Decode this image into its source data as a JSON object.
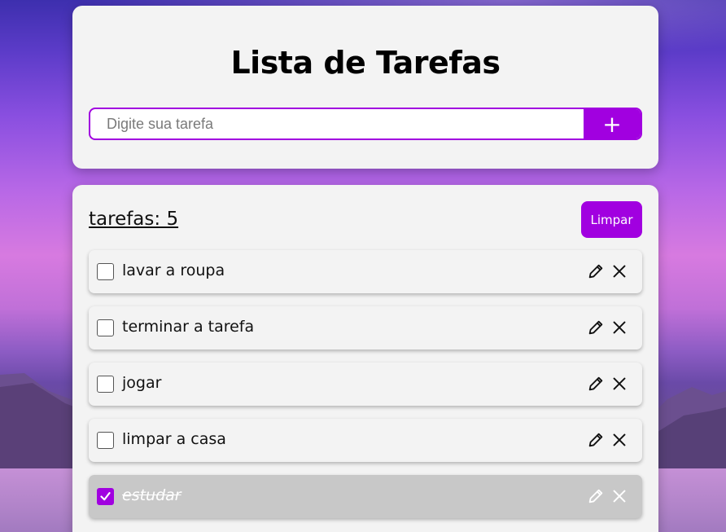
{
  "header": {
    "title": "Lista de Tarefas",
    "input_placeholder": "Digite sua tarefa",
    "input_value": "",
    "add_label": "+"
  },
  "list": {
    "count_label": "tarefas: 5",
    "clear_label": "Limpar",
    "items": [
      {
        "label": "lavar a roupa",
        "done": false
      },
      {
        "label": "terminar a tarefa",
        "done": false
      },
      {
        "label": "jogar",
        "done": false
      },
      {
        "label": "limpar a casa",
        "done": false
      },
      {
        "label": "estudar",
        "done": true
      }
    ]
  },
  "colors": {
    "accent": "#a100e0",
    "card": "#f3f3f3",
    "done_item": "#c8c8c8"
  },
  "icons": {
    "edit": "pencil-icon",
    "delete": "close-icon",
    "check": "check-icon"
  }
}
